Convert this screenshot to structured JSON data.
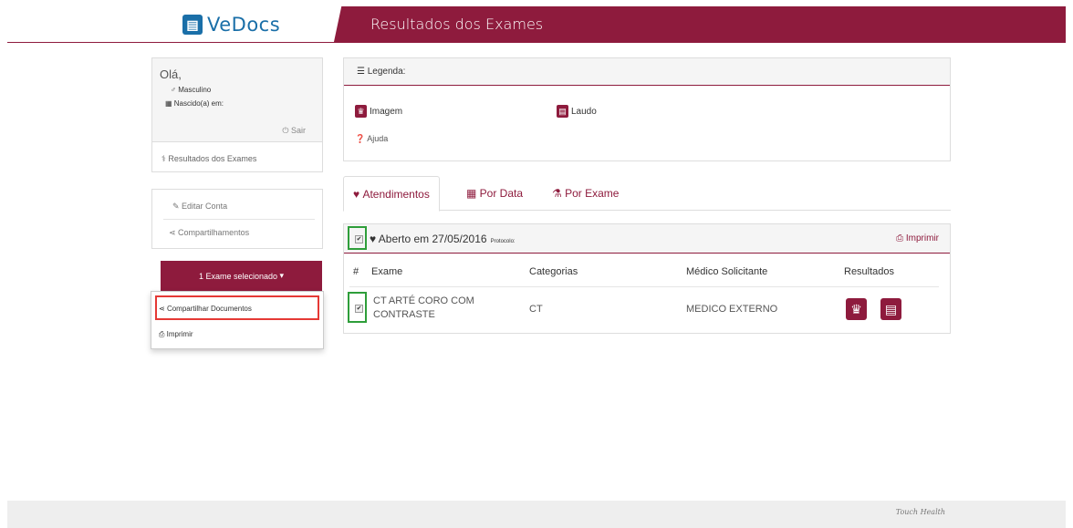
{
  "header": {
    "logo_text": "VeDocs",
    "logo_icon": "document-icon",
    "page_title": "Resultados dos Exames",
    "brand_color": "#8e1b3d",
    "logo_color": "#1a6fa8"
  },
  "user": {
    "greeting": "Olá,",
    "gender": "Masculino",
    "born": "Nascido(a) em:",
    "logout": "Sair",
    "results_link": "Resultados dos Exames"
  },
  "account": {
    "edit": "Editar Conta",
    "shares": "Compartilhamentos"
  },
  "selection": {
    "button": "1 Exame selecionado",
    "menu": [
      "Compartilhar Documentos",
      "Imprimir"
    ]
  },
  "legend": {
    "title": "Legenda:",
    "image": "Imagem",
    "report": "Laudo",
    "help": "Ajuda"
  },
  "tabs": [
    {
      "label": "Atendimentos",
      "icon": "heart-icon",
      "active": true
    },
    {
      "label": "Por Data",
      "icon": "calendar-icon",
      "active": false
    },
    {
      "label": "Por Exame",
      "icon": "flask-icon",
      "active": false
    }
  ],
  "appointment": {
    "opened": "Aberto em 27/05/2016",
    "protocol": "Protocolo:",
    "print": "Imprimir"
  },
  "table": {
    "columns": [
      "#",
      "Exame",
      "Categorias",
      "Médico Solicitante",
      "Resultados"
    ],
    "rows": [
      {
        "exam_line1": "CT ARTÉ CORO COM",
        "exam_line2": "CONTRASTE",
        "category": "CT",
        "doctor": "MEDICO EXTERNO"
      }
    ]
  },
  "footer": {
    "brand": "Touch Health"
  }
}
